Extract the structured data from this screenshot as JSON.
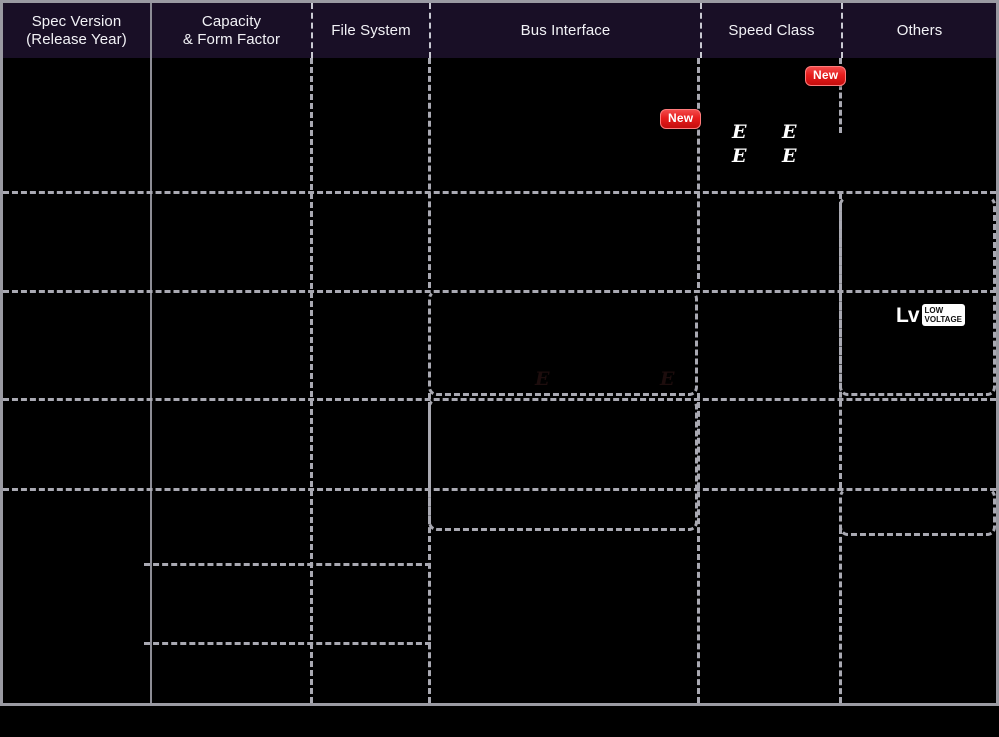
{
  "table": {
    "columns": [
      {
        "id": "spec-version",
        "title": "Spec Version",
        "subtitle": "(Release Year)"
      },
      {
        "id": "capacity-form-factor",
        "title": "Capacity",
        "subtitle": "& Form Factor"
      },
      {
        "id": "file-system",
        "title": "File System",
        "subtitle": ""
      },
      {
        "id": "bus-interface",
        "title": "Bus Interface",
        "subtitle": ""
      },
      {
        "id": "speed-class",
        "title": "Speed Class",
        "subtitle": ""
      },
      {
        "id": "others",
        "title": "Others",
        "subtitle": ""
      }
    ]
  },
  "badges": {
    "new_label": "New",
    "items": [
      {
        "id": "new-badge-bus-interface",
        "label": "New"
      },
      {
        "id": "new-badge-speed-class",
        "label": "New"
      }
    ]
  },
  "speed_class_glyphs": {
    "label": "E",
    "items": [
      {
        "id": "speed-class-glyph-1",
        "label": "E"
      },
      {
        "id": "speed-class-glyph-2",
        "label": "E"
      },
      {
        "id": "speed-class-glyph-3",
        "label": "E"
      },
      {
        "id": "speed-class-glyph-4",
        "label": "E"
      }
    ]
  },
  "faint_glyphs": {
    "items": [
      {
        "id": "faint-glyph-1",
        "label": "E"
      },
      {
        "id": "faint-glyph-2",
        "label": "E"
      }
    ]
  },
  "lv_logo": {
    "mark": "Lv",
    "line1": "LOW",
    "line2": "VOLTAGE"
  },
  "colors": {
    "header_background": "#190f26",
    "page_background": "#000000",
    "frame_border": "#9a9aa2",
    "grid_dash": "#a9a9b2",
    "grid_solid": "#8d8d96",
    "badge_red": "#e71d1d",
    "text_primary": "#f2f2f6"
  }
}
